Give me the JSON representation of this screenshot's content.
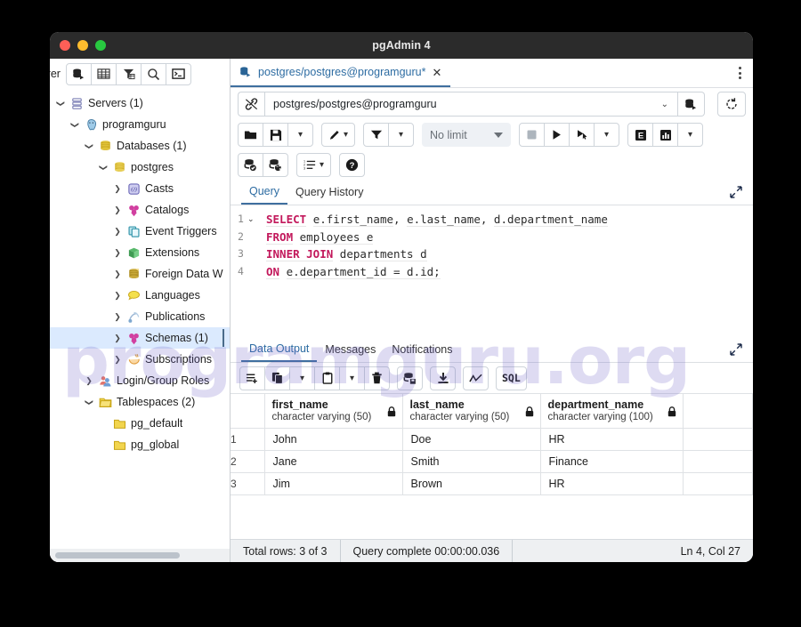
{
  "window": {
    "title": "pgAdmin 4",
    "traffic_lights": [
      "close-red",
      "minimize-yellow",
      "maximize-green"
    ]
  },
  "watermark": {
    "text": "programguru.org",
    "color": "#6b5fc7"
  },
  "explorer": {
    "label": "plorer",
    "toolbar": [
      {
        "name": "query-tool-icon",
        "title": "Query Tool"
      },
      {
        "name": "view-data-icon",
        "title": "View Data"
      },
      {
        "name": "filter-table-icon",
        "title": "Filtered Rows"
      },
      {
        "name": "search-icon",
        "title": "Search Objects"
      },
      {
        "name": "psql-terminal-icon",
        "title": "PSQL Tool"
      }
    ],
    "tree": [
      {
        "label": "Servers (1)",
        "indent": 0,
        "arrow": "down",
        "icon": "servers-icon",
        "selected": false
      },
      {
        "label": "programguru",
        "indent": 1,
        "arrow": "down",
        "icon": "postgres-elephant-icon",
        "selected": false
      },
      {
        "label": "Databases (1)",
        "indent": 2,
        "arrow": "down",
        "icon": "databases-icon",
        "selected": false
      },
      {
        "label": "postgres",
        "indent": 3,
        "arrow": "down",
        "icon": "database-icon",
        "selected": false
      },
      {
        "label": "Casts",
        "indent": 4,
        "arrow": "right",
        "icon": "casts-icon",
        "selected": false
      },
      {
        "label": "Catalogs",
        "indent": 4,
        "arrow": "right",
        "icon": "catalogs-icon",
        "selected": false
      },
      {
        "label": "Event Triggers",
        "indent": 4,
        "arrow": "right",
        "icon": "event-triggers-icon",
        "selected": false
      },
      {
        "label": "Extensions",
        "indent": 4,
        "arrow": "right",
        "icon": "extensions-icon",
        "selected": false
      },
      {
        "label": "Foreign Data W",
        "indent": 4,
        "arrow": "right",
        "icon": "foreign-data-wrappers-icon",
        "selected": false
      },
      {
        "label": "Languages",
        "indent": 4,
        "arrow": "right",
        "icon": "languages-icon",
        "selected": false
      },
      {
        "label": "Publications",
        "indent": 4,
        "arrow": "right",
        "icon": "publications-icon",
        "selected": false
      },
      {
        "label": "Schemas (1)",
        "indent": 4,
        "arrow": "right",
        "icon": "schemas-icon",
        "selected": true
      },
      {
        "label": "Subscriptions",
        "indent": 4,
        "arrow": "right",
        "icon": "subscriptions-icon",
        "selected": false
      },
      {
        "label": "Login/Group Roles",
        "indent": 2,
        "arrow": "right",
        "icon": "login-group-roles-icon",
        "selected": false
      },
      {
        "label": "Tablespaces (2)",
        "indent": 2,
        "arrow": "down",
        "icon": "tablespaces-icon",
        "selected": false
      },
      {
        "label": "pg_default",
        "indent": 3,
        "arrow": "none",
        "icon": "folder-icon",
        "selected": false
      },
      {
        "label": "pg_global",
        "indent": 3,
        "arrow": "none",
        "icon": "folder-icon",
        "selected": false
      }
    ]
  },
  "tabstrip": {
    "tab_label": "postgres/postgres@programguru*",
    "tab_icon": "database-tab-icon",
    "close_label": "✕",
    "kebab_name": "more-options-icon"
  },
  "connection": {
    "icon": "disconnect-icon",
    "value": "postgres/postgres@programguru",
    "caret": "⌄",
    "db_icon": "connection-database-icon",
    "refresh_icon": "refresh-icon"
  },
  "toolbar": {
    "row1": [
      {
        "name": "open-file-button",
        "icon": "folder-open-icon"
      },
      {
        "name": "save-file-button",
        "icon": "save-icon"
      },
      {
        "name": "save-dropdown-button",
        "icon": "chevron-down-icon"
      },
      {
        "name": "edit-button",
        "icon": "pencil-icon"
      },
      {
        "name": "edit-dropdown-button",
        "icon": "chevron-down-icon"
      },
      {
        "name": "filter-button",
        "icon": "funnel-icon"
      },
      {
        "name": "filter-dropdown-button",
        "icon": "chevron-down-icon"
      },
      {
        "name": "stop-button",
        "icon": "stop-square-icon"
      },
      {
        "name": "execute-button",
        "icon": "play-icon"
      },
      {
        "name": "execute-cursor-button",
        "icon": "play-cursor-icon"
      },
      {
        "name": "execute-dropdown-button",
        "icon": "chevron-down-icon"
      },
      {
        "name": "explain-button",
        "icon": "explain-e-icon"
      },
      {
        "name": "explain-analyze-button",
        "icon": "chart-bars-icon"
      },
      {
        "name": "explain-dropdown-button",
        "icon": "chevron-down-icon"
      }
    ],
    "limit": {
      "label": "No limit"
    },
    "row2": [
      {
        "name": "commit-button",
        "icon": "commit-check-icon"
      },
      {
        "name": "rollback-button",
        "icon": "rollback-arrow-icon"
      },
      {
        "name": "macros-button",
        "icon": "numbered-list-icon"
      },
      {
        "name": "help-button",
        "icon": "help-circle-icon"
      }
    ]
  },
  "query_panel": {
    "tabs": [
      {
        "label": "Query",
        "active": true
      },
      {
        "label": "Query History",
        "active": false
      }
    ],
    "expand_icon": "expand-diagonal-icon",
    "lines": [
      {
        "num": "1",
        "fold": "⌄",
        "tokens": [
          {
            "t": "SELECT",
            "c": "kw"
          },
          {
            "t": " ",
            "c": "pl"
          },
          {
            "t": "e.first_name",
            "c": "id"
          },
          {
            "t": ", ",
            "c": "pl"
          },
          {
            "t": "e.last_name",
            "c": "id"
          },
          {
            "t": ", ",
            "c": "pl"
          },
          {
            "t": "d.department_name",
            "c": "id"
          }
        ]
      },
      {
        "num": "2",
        "fold": "",
        "tokens": [
          {
            "t": "FROM",
            "c": "kw"
          },
          {
            "t": " ",
            "c": "pl"
          },
          {
            "t": "employees e",
            "c": "id"
          }
        ]
      },
      {
        "num": "3",
        "fold": "",
        "tokens": [
          {
            "t": "INNER JOIN",
            "c": "kw"
          },
          {
            "t": " ",
            "c": "pl"
          },
          {
            "t": "departments d",
            "c": "id"
          }
        ]
      },
      {
        "num": "4",
        "fold": "",
        "tokens": [
          {
            "t": "ON",
            "c": "kw"
          },
          {
            "t": " ",
            "c": "pl"
          },
          {
            "t": "e.department_id = d.id;",
            "c": "id"
          }
        ]
      }
    ]
  },
  "output_panel": {
    "tabs": [
      {
        "label": "Data Output",
        "active": true
      },
      {
        "label": "Messages",
        "active": false
      },
      {
        "label": "Notifications",
        "active": false
      }
    ],
    "expand_icon": "expand-diagonal-icon",
    "toolbar": [
      {
        "name": "add-row-button",
        "icon": "add-row-icon"
      },
      {
        "name": "copy-button",
        "icon": "copy-icon"
      },
      {
        "name": "copy-dropdown-button",
        "icon": "chevron-down-icon"
      },
      {
        "name": "paste-button",
        "icon": "paste-icon"
      },
      {
        "name": "paste-dropdown-button",
        "icon": "chevron-down-icon"
      },
      {
        "name": "delete-row-button",
        "icon": "trash-icon"
      },
      {
        "name": "save-data-button",
        "icon": "save-data-icon"
      },
      {
        "name": "download-csv-button",
        "icon": "download-icon"
      },
      {
        "name": "graph-visualiser-button",
        "icon": "line-chart-icon"
      },
      {
        "name": "query-sql-button",
        "icon": "sql-text-icon",
        "label": "SQL"
      }
    ],
    "columns": [
      {
        "name": "first_name",
        "type": "character varying (50)",
        "lock": "lock-icon"
      },
      {
        "name": "last_name",
        "type": "character varying (50)",
        "lock": "lock-icon"
      },
      {
        "name": "department_name",
        "type": "character varying (100)",
        "lock": "lock-icon"
      }
    ],
    "rows": [
      {
        "num": "1",
        "cells": [
          "John",
          "Doe",
          "HR"
        ]
      },
      {
        "num": "2",
        "cells": [
          "Jane",
          "Smith",
          "Finance"
        ]
      },
      {
        "num": "3",
        "cells": [
          "Jim",
          "Brown",
          "HR"
        ]
      }
    ]
  },
  "statusbar": {
    "total_rows": "Total rows: 3 of 3",
    "query_status": "Query complete 00:00:00.036",
    "cursor_position": "Ln 4, Col 27"
  }
}
